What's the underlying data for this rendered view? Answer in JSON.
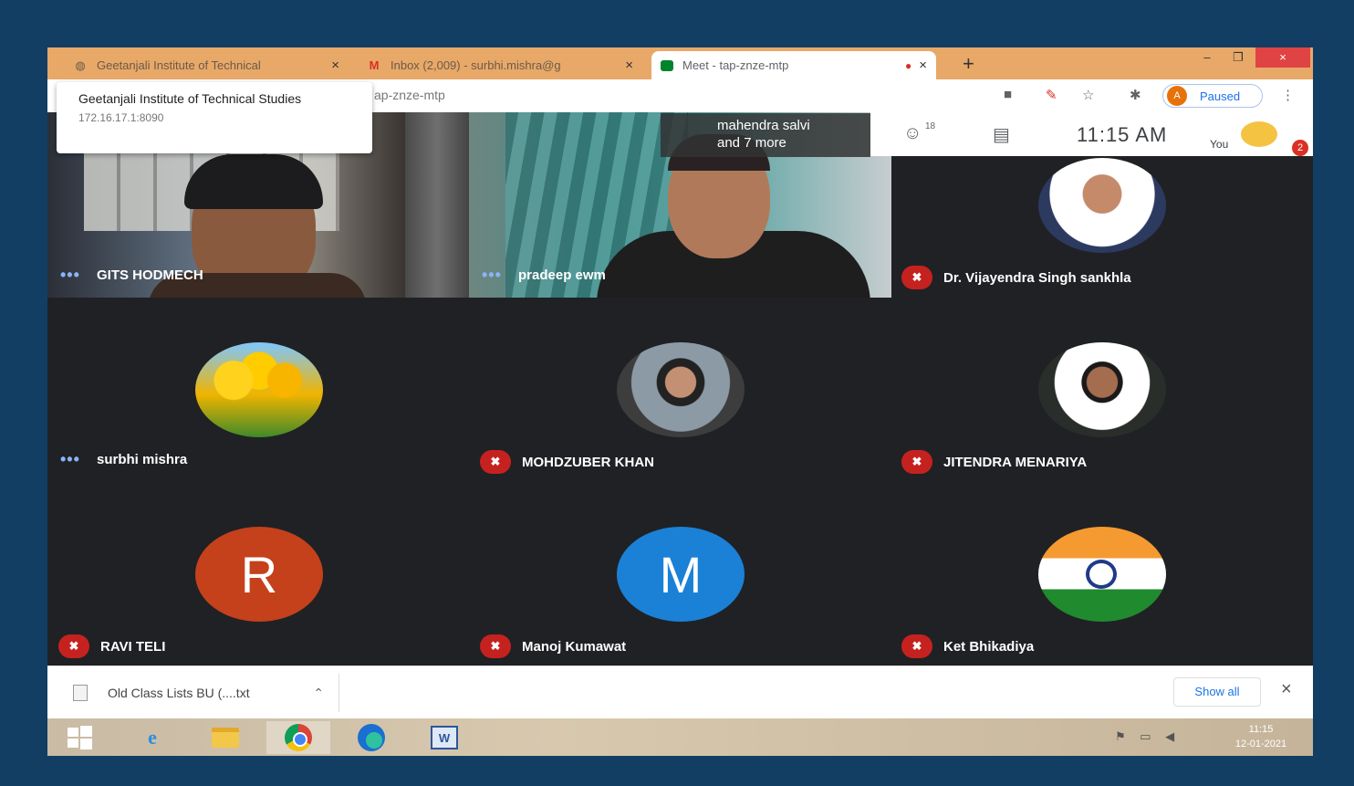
{
  "browser": {
    "tabs": [
      {
        "label": "Geetanjali Institute of Technical",
        "close": "×",
        "icon": "globe-icon"
      },
      {
        "label": "Inbox (2,009) - surbhi.mishra@g",
        "close": "×",
        "icon": "gmail-icon"
      },
      {
        "label": "Meet - tap-znze-mtp",
        "close": "×",
        "icon": "meet-icon"
      }
    ],
    "new_tab": "+",
    "address": "ap-znze-mtp",
    "profile_initial": "A",
    "profile_status": "Paused",
    "window_buttons": {
      "minimize": "–",
      "restore": "❐",
      "close": "×"
    }
  },
  "tooltip": {
    "title": "Geetanjali Institute of Technical Studies",
    "address": "172.16.17.1:8090"
  },
  "meet": {
    "more_label_line1": "mahendra salvi",
    "more_label_line2": "and 7 more",
    "participant_count": "18",
    "clock": "11:15 AM",
    "you_label": "You",
    "notification_count": "2",
    "tiles": [
      {
        "name": "GITS HODMECH",
        "mic": "speaking"
      },
      {
        "name": "pradeep ewm",
        "mic": "speaking"
      },
      {
        "name": "Dr. Vijayendra Singh sankhla",
        "mic": "muted"
      },
      {
        "name": "surbhi mishra",
        "mic": "speaking"
      },
      {
        "name": "MOHDZUBER KHAN",
        "mic": "muted"
      },
      {
        "name": "JITENDRA MENARIYA",
        "mic": "muted"
      },
      {
        "name": "RAVI TELI",
        "mic": "muted",
        "initial": "R"
      },
      {
        "name": "Manoj Kumawat",
        "mic": "muted",
        "initial": "M"
      },
      {
        "name": "Ket Bhikadiya",
        "mic": "muted"
      }
    ]
  },
  "downloads": {
    "file_name": "Old Class Lists BU (....txt",
    "show_all": "Show all",
    "close": "×"
  },
  "taskbar": {
    "time": "11:15",
    "date": "12-01-2021"
  },
  "colors": {
    "desktop_bg": "#123e63",
    "meet_bg": "#202124",
    "mic_muted": "#c5221f",
    "tab_strip": "#e8a868"
  }
}
